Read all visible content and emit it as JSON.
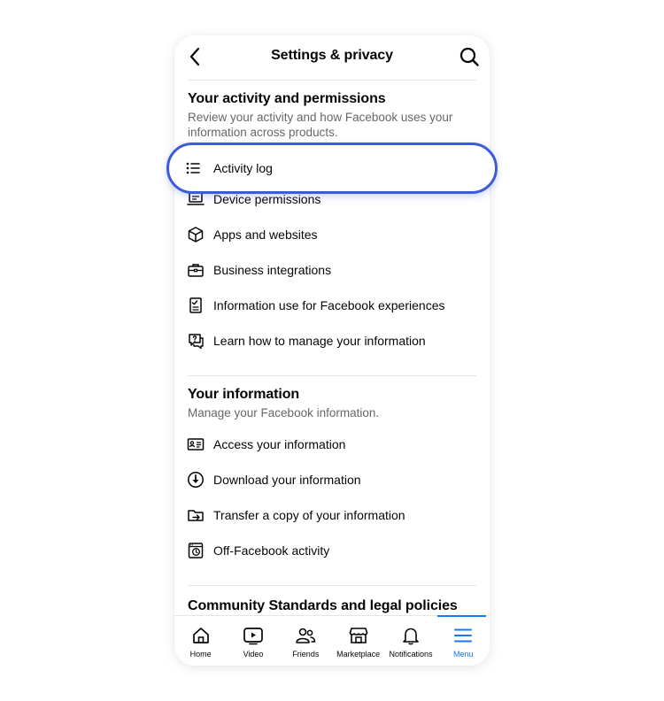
{
  "header": {
    "title": "Settings & privacy",
    "back_icon": "chevron-left-icon",
    "search_icon": "search-icon"
  },
  "sections": [
    {
      "title": "Your activity and permissions",
      "subtitle": "Review your activity and how Facebook uses your information across products.",
      "items": [
        {
          "label": "Activity log",
          "icon": "list-icon",
          "highlighted": true
        },
        {
          "label": "Device permissions",
          "icon": "laptop-icon"
        },
        {
          "label": "Apps and websites",
          "icon": "cube-icon"
        },
        {
          "label": "Business integrations",
          "icon": "briefcase-icon"
        },
        {
          "label": "Information use for Facebook experiences",
          "icon": "checklist-icon"
        },
        {
          "label": "Learn how to manage your information",
          "icon": "question-bubble-icon"
        }
      ]
    },
    {
      "title": "Your information",
      "subtitle": "Manage your Facebook information.",
      "items": [
        {
          "label": "Access your information",
          "icon": "id-card-icon"
        },
        {
          "label": "Download your information",
          "icon": "download-icon"
        },
        {
          "label": "Transfer a copy of your information",
          "icon": "folder-transfer-icon"
        },
        {
          "label": "Off-Facebook activity",
          "icon": "history-icon"
        }
      ]
    },
    {
      "title": "Community Standards and legal policies"
    }
  ],
  "bottom_nav": [
    {
      "label": "Home",
      "icon": "home-icon"
    },
    {
      "label": "Video",
      "icon": "video-icon"
    },
    {
      "label": "Friends",
      "icon": "friends-icon"
    },
    {
      "label": "Marketplace",
      "icon": "marketplace-icon"
    },
    {
      "label": "Notifications",
      "icon": "bell-icon"
    },
    {
      "label": "Menu",
      "icon": "menu-icon",
      "active": true
    }
  ],
  "colors": {
    "accent": "#1877f2",
    "highlight_border": "#3b5bdb",
    "secondary_text": "#65676b",
    "divider": "#e4e6eb"
  }
}
